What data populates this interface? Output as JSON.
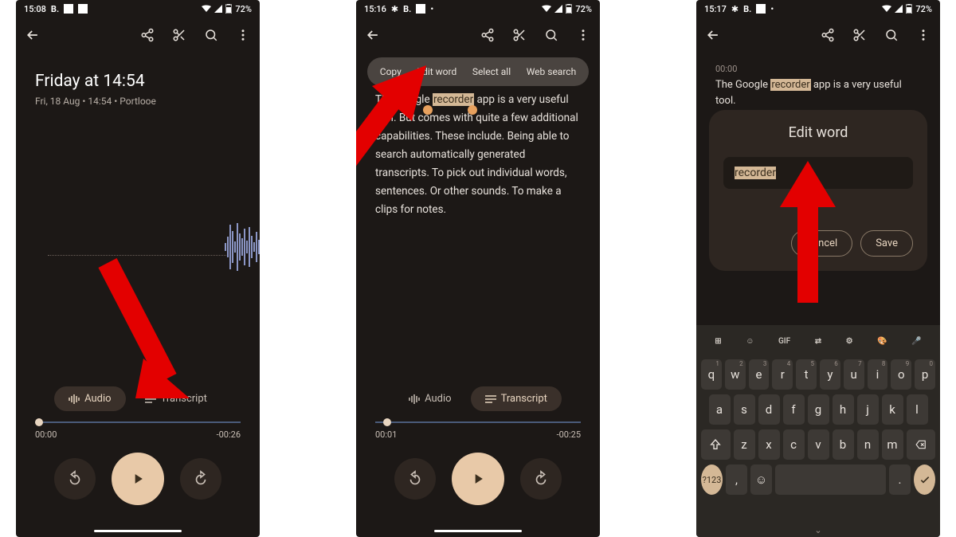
{
  "status": {
    "battery": "72%"
  },
  "phone1": {
    "time": "15:08",
    "title": "Friday at 14:54",
    "subtitle": "Fri, 18 Aug • 14:54 • Portlooe",
    "tabs": {
      "audio": "Audio",
      "transcript": "Transcript"
    },
    "progress": {
      "start": "00:00",
      "end": "-00:26",
      "pct": 0
    }
  },
  "phone2": {
    "time": "15:16",
    "context_menu": [
      "Copy",
      "Edit word",
      "Select all",
      "Web search"
    ],
    "transcript": {
      "pre": "The Google ",
      "highlight": "recorder",
      "post": " app is a very useful tool. But comes with quite a few additional capabilities. These include. Being able to search automatically generated transcripts. To pick out individual words, sentences. Or other sounds. To make a clips for notes."
    },
    "tabs": {
      "audio": "Audio",
      "transcript": "Transcript"
    },
    "progress": {
      "start": "00:01",
      "end": "-00:25",
      "pct": 4
    }
  },
  "phone3": {
    "time": "15:17",
    "timecode": "00:00",
    "transcript": {
      "pre": "The Google ",
      "highlight": "recorder",
      "post": " app is a very useful tool."
    },
    "dialog": {
      "title": "Edit word",
      "input": "recorder",
      "cancel": "Cancel",
      "save": "Save"
    },
    "keyboard": {
      "suggest_labels": [
        "sticker",
        "GIF",
        "translate",
        "settings",
        "palette",
        "mic"
      ],
      "row1": [
        [
          "q",
          "1"
        ],
        [
          "w",
          "2"
        ],
        [
          "e",
          "3"
        ],
        [
          "r",
          "4"
        ],
        [
          "t",
          "5"
        ],
        [
          "y",
          "6"
        ],
        [
          "u",
          "7"
        ],
        [
          "i",
          "8"
        ],
        [
          "o",
          "9"
        ],
        [
          "p",
          "0"
        ]
      ],
      "row2": [
        "a",
        "s",
        "d",
        "f",
        "g",
        "h",
        "j",
        "k",
        "l"
      ],
      "row3": [
        "z",
        "x",
        "c",
        "v",
        "b",
        "n",
        "m"
      ],
      "sym": "?123",
      "comma": ",",
      "period": "."
    }
  }
}
